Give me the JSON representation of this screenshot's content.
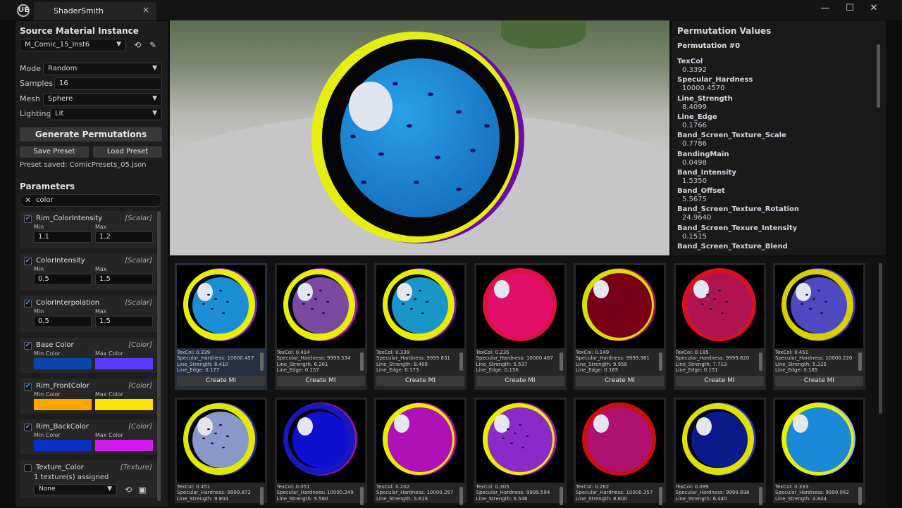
{
  "app": {
    "tab_title": "ShaderSmith",
    "logo": "UE",
    "close": "×",
    "min": "—",
    "max": "☐",
    "winclose": "✕"
  },
  "left": {
    "source_title": "Source Material Instance",
    "material": "M_Comic_15_Inst6",
    "fields": [
      {
        "label": "Mode",
        "value": "Random",
        "type": "dropdown"
      },
      {
        "label": "Samples",
        "value": "16",
        "type": "text"
      },
      {
        "label": "Mesh",
        "value": "Sphere",
        "type": "dropdown"
      },
      {
        "label": "Lighting",
        "value": "Lit",
        "type": "dropdown"
      }
    ],
    "generate_label": "Generate Permutations",
    "save_label": "Save Preset",
    "load_label": "Load Preset",
    "message": "Preset saved: ComicPresets_05.json",
    "params_title": "Parameters",
    "search_value": "color",
    "params": [
      {
        "name": "Rim_ColorIntensity",
        "type": "[Scalar]",
        "min_label": "Min",
        "max_label": "Max",
        "min": "1.1",
        "max": "1.2"
      },
      {
        "name": "ColorIntensity",
        "type": "[Scalar]",
        "min_label": "Min",
        "max_label": "Max",
        "min": "0.5",
        "max": "1.5"
      },
      {
        "name": "ColorInterpolation",
        "type": "[Scalar]",
        "min_label": "Min",
        "max_label": "Max",
        "min": "0.5",
        "max": "1.5"
      },
      {
        "name": "Base Color",
        "type": "[Color]",
        "min_label": "Min Color",
        "max_label": "Max Color",
        "min_color": "#0b47a8",
        "max_color": "#5b3cff"
      },
      {
        "name": "Rim_FrontColor",
        "type": "[Color]",
        "min_label": "Min Color",
        "max_label": "Max Color",
        "min_color": "#ffa400",
        "max_color": "#ffe300"
      },
      {
        "name": "Rim_BackColor",
        "type": "[Color]",
        "min_label": "Min Color",
        "max_label": "Max Color",
        "min_color": "#0a2fc8",
        "max_color": "#d51cf0"
      }
    ],
    "texture": {
      "name": "Texture_Color",
      "type": "[Texture]",
      "assigned": "1 texture(s) assigned",
      "value": "None"
    }
  },
  "perm": {
    "title": "Permutation Values",
    "index": "Permutation #0",
    "values": [
      {
        "name": "TexCol",
        "value": "0.3392"
      },
      {
        "name": "Specular_Hardness",
        "value": "10000.4570"
      },
      {
        "name": "Line_Strength",
        "value": "8.4099"
      },
      {
        "name": "Line_Edge",
        "value": "0.1766"
      },
      {
        "name": "Band_Screen_Texture_Scale",
        "value": "0.7786"
      },
      {
        "name": "BandingMain",
        "value": "0.0498"
      },
      {
        "name": "Band_Intensity",
        "value": "1.5350"
      },
      {
        "name": "Band_Offset",
        "value": "5.5675"
      },
      {
        "name": "Band_Screen_Texture_Rotation",
        "value": "24.9640"
      },
      {
        "name": "Band_Screen_Texure_Intensity",
        "value": "0.1515"
      },
      {
        "name": "Band_Screen_Texture_Blend",
        "value": ""
      }
    ]
  },
  "create_label": "Create MI",
  "cards": [
    {
      "texcol": "TexCol: 0.339",
      "spec": "Specular_Hardness: 10000.457",
      "line": "Line_Strength: 8.410",
      "edge": "Line_Edge: 0.177",
      "fill": "#1b8fd6",
      "rim": "#e8f000",
      "rim2": "#7a1bd0",
      "ring": true,
      "dots": true
    },
    {
      "texcol": "TexCol: 0.414",
      "spec": "Specular_Hardness: 9999.534",
      "line": "Line_Strength: 6.261",
      "edge": "Line_Edge: 0.157",
      "fill": "#7a4aa0",
      "rim": "#e6f000",
      "rim2": "#c000e0",
      "ring": true,
      "dots": true
    },
    {
      "texcol": "TexCol: 0.339",
      "spec": "Specular_Hardness: 9999.831",
      "line": "Line_Strength: 8.409",
      "edge": "Line_Edge: 0.173",
      "fill": "#1a95c8",
      "rim": "#e6ee00",
      "rim2": "#7010c0",
      "ring": true,
      "dots": true
    },
    {
      "texcol": "TexCol: 0.235",
      "spec": "Specular_Hardness: 10000.487",
      "line": "Line_Strength: 5.537",
      "edge": "Line_Edge: 0.156",
      "fill": "#e0106a",
      "rim": "#e01040",
      "rim2": "#e01040",
      "ring": false,
      "dots": false
    },
    {
      "texcol": "TexCol: 0.149",
      "spec": "Specular_Hardness: 9999.981",
      "line": "Line_Strength: 9.958",
      "edge": "Line_Edge: 0.165",
      "fill": "#7a0018",
      "rim": "#d8e000",
      "rim2": "#a01060",
      "ring": false,
      "dots": false
    },
    {
      "texcol": "TexCol: 0.185",
      "spec": "Specular_Hardness: 9999.620",
      "line": "Line_Strength: 7.713",
      "edge": "Line_Edge: 0.151",
      "fill": "#b01450",
      "rim": "#d81020",
      "rim2": "#d81020",
      "ring": false,
      "dots": true
    },
    {
      "texcol": "TexCol: 0.451",
      "spec": "Specular_Hardness: 10000.220",
      "line": "Line_Strength: 5.225",
      "edge": "Line_Edge: 0.185",
      "fill": "#5048c0",
      "rim": "#d8d000",
      "rim2": "#4a2ac0",
      "ring": true,
      "dots": true
    },
    {
      "texcol": "TexCol: 0.451",
      "spec": "Specular_Hardness: 9999.872",
      "line": "Line_Strength: 9.804",
      "edge": "",
      "fill": "#8898c8",
      "rim": "#e0e800",
      "rim2": "#3028b0",
      "ring": true,
      "dots": true
    },
    {
      "texcol": "TexCol: 0.051",
      "spec": "Specular_Hardness: 10000.249",
      "line": "Line_Strength: 9.560",
      "edge": "",
      "fill": "#1010d0",
      "rim": "#1818c0",
      "rim2": "#a010a0",
      "ring": true,
      "dots": false
    },
    {
      "texcol": "TexCol: 0.202",
      "spec": "Specular_Hardness: 10000.257",
      "line": "Line_Strength: 5.619",
      "edge": "",
      "fill": "#b010b8",
      "rim": "#e8ee00",
      "rim2": "#c000c0",
      "ring": false,
      "dots": false
    },
    {
      "texcol": "TexCol: 0.305",
      "spec": "Specular_Hardness: 9999.594",
      "line": "Line_Strength: 6.546",
      "edge": "",
      "fill": "#8a2ac8",
      "rim": "#e8ee00",
      "rim2": "#b010c0",
      "ring": false,
      "dots": true
    },
    {
      "texcol": "TexCol: 0.262",
      "spec": "Specular_Hardness: 10000.357",
      "line": "Line_Strength: 8.600",
      "edge": "",
      "fill": "#b01070",
      "rim": "#c81010",
      "rim2": "#c81010",
      "ring": false,
      "dots": false
    },
    {
      "texcol": "TexCol: 0.099",
      "spec": "Specular_Hardness: 9999.698",
      "line": "Line_Strength: 6.440",
      "edge": "",
      "fill": "#0a1a8a",
      "rim": "#e0e000",
      "rim2": "#2030c0",
      "ring": true,
      "dots": false
    },
    {
      "texcol": "TexCol: 0.333",
      "spec": "Specular_Hardness: 9999.962",
      "line": "Line_Strength: 4.844",
      "edge": "",
      "fill": "#1a8ad8",
      "rim": "#e8f000",
      "rim2": "#a0b8e0",
      "ring": false,
      "dots": false
    }
  ]
}
